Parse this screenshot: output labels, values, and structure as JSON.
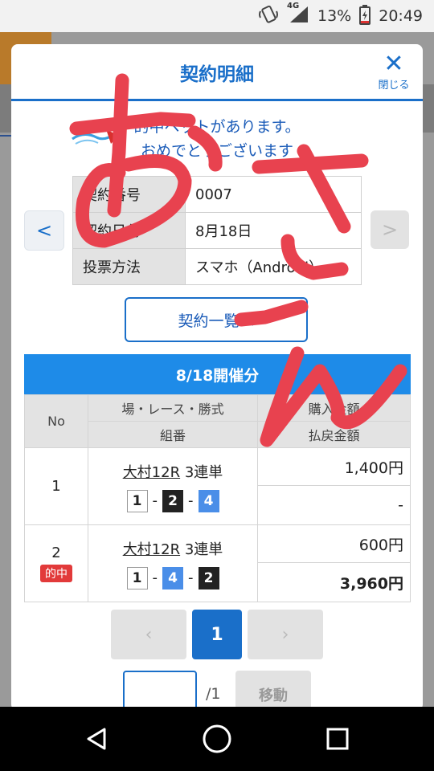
{
  "status_bar": {
    "network": "4G",
    "battery": "13%",
    "time": "20:49"
  },
  "modal": {
    "title": "契約明細",
    "close_label": "閉じる",
    "hit_message_line1": "的中ベットがあります。",
    "hit_message_line2": "おめでとうございます",
    "prev_label": "<",
    "next_label": ">",
    "info_rows": [
      {
        "key": "契約番号",
        "value": "0007"
      },
      {
        "key": "契約日付",
        "value": "8月18日"
      },
      {
        "key": "投票方法",
        "value": "スマホ（Android）"
      }
    ],
    "contract_list_button": "契約一覧へ",
    "day_header": "8/18開催分",
    "table_headers": {
      "no": "No",
      "race": "場・レース・勝式",
      "combo": "組番",
      "amount": "購入金額",
      "payout": "払戻金額"
    },
    "bets": [
      {
        "no": "1",
        "place_race": "大村12R",
        "bet_type": "3連単",
        "numbers": [
          "1",
          "2",
          "4"
        ],
        "amount": "1,400円",
        "payout": "-",
        "hit_badge": ""
      },
      {
        "no": "2",
        "place_race": "大村12R",
        "bet_type": "3連単",
        "numbers": [
          "1",
          "4",
          "2"
        ],
        "amount": "600円",
        "payout": "3,960円",
        "hit_badge": "的中"
      }
    ],
    "pagination": {
      "prev": "‹",
      "current": "1",
      "next": "›",
      "input_value": "",
      "total": "/1",
      "move_button": "移動"
    }
  },
  "colors": {
    "accent": "#1a6fc9",
    "day_bar": "#1e8be8",
    "hit": "#e23a3a",
    "scribble": "#e8424f"
  },
  "icons": [
    "vibrate-icon",
    "signal-icon",
    "battery-icon",
    "close-icon",
    "back-icon",
    "home-icon",
    "recents-icon"
  ]
}
